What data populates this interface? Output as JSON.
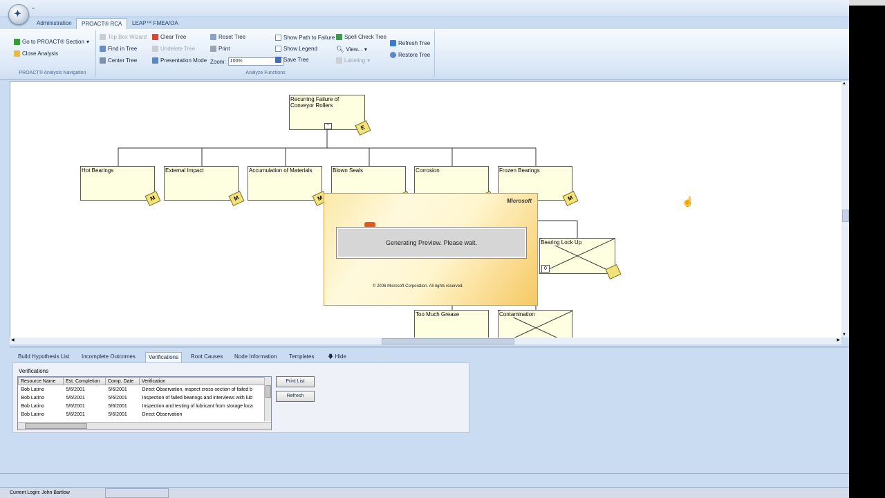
{
  "qat_arrow": "⁼",
  "tabs": [
    "Administration",
    "PROACT® RCA",
    "LEAP™ FMEA/OA"
  ],
  "active_tab": 1,
  "ribbon": {
    "nav_group": {
      "label": "PROACT® Analysis Navigation",
      "goto_section": "Go to PROACT® Section",
      "close_analysis": "Close Analysis"
    },
    "analyze_group": {
      "label": "Analyze Functions",
      "top_box_wizard": "Top Box Wizard",
      "find_in_tree": "Find in Tree",
      "center_tree": "Center Tree",
      "clear_tree": "Clear Tree",
      "undelete_tree": "Undelete Tree",
      "presentation_mode": "Presentation Mode",
      "reset_tree": "Reset Tree",
      "print": "Print",
      "zoom_label": "Zoom:",
      "zoom_value": "100%",
      "show_path_to_failure": "Show Path to Failure",
      "show_legend": "Show Legend",
      "save_tree": "Save Tree",
      "spell_check_tree": "Spell Check Tree",
      "view": "View...",
      "labeling": "Labeling",
      "refresh_tree": "Refresh Tree",
      "restore_tree": "Restore Tree"
    }
  },
  "tree": {
    "root": {
      "label": "Recurring Failure of Conveyor Rollers",
      "badge": "E",
      "expander": "−"
    },
    "children": [
      {
        "label": "Hot Bearings",
        "badge": "M"
      },
      {
        "label": "External Impact",
        "badge": "M"
      },
      {
        "label": "Accumulation of Materials",
        "badge": "M"
      },
      {
        "label": "Blown Seals",
        "badge": "M"
      },
      {
        "label": "Corrosion",
        "badge": "M"
      },
      {
        "label": "Frozen Bearings",
        "badge": "M"
      }
    ],
    "lower_nodes": [
      {
        "label": "Bearing Lock Up",
        "count": "0"
      },
      {
        "label": "Too Much Grease"
      },
      {
        "label": "Contamination"
      }
    ]
  },
  "splash": {
    "brand": "Microsoft",
    "message": "Generating Preview. Please wait.",
    "copyright": "© 2006 Microsoft Corporation.  All rights reserved."
  },
  "bottom_tabs": [
    "Build Hypothesis List",
    "Incomplete Outcomes",
    "Verifications",
    "Root Causes",
    "Node Information",
    "Templates",
    "Hide"
  ],
  "active_bottom_tab": 2,
  "verifications": {
    "title": "Verifications",
    "columns": [
      "Resource Name",
      "Est. Completion",
      "Comp. Date",
      "Verification"
    ],
    "rows": [
      [
        "Bob Latino",
        "5/6/2001",
        "5/6/2001",
        "Direct Observation, inspect cross-section of failed b"
      ],
      [
        "Bob Latino",
        "5/6/2001",
        "5/6/2001",
        "Inspection of failed bearings and interviews with lub"
      ],
      [
        "Bob Latino",
        "5/6/2001",
        "5/6/2001",
        "Inspection and testing of lubricant from storage loca"
      ],
      [
        "Bob Latino",
        "5/6/2001",
        "5/6/2001",
        "Direct Observation"
      ]
    ],
    "print_list": "Print List",
    "refresh": "Refresh"
  },
  "status": {
    "login": "Current Login: John Bartlow"
  }
}
